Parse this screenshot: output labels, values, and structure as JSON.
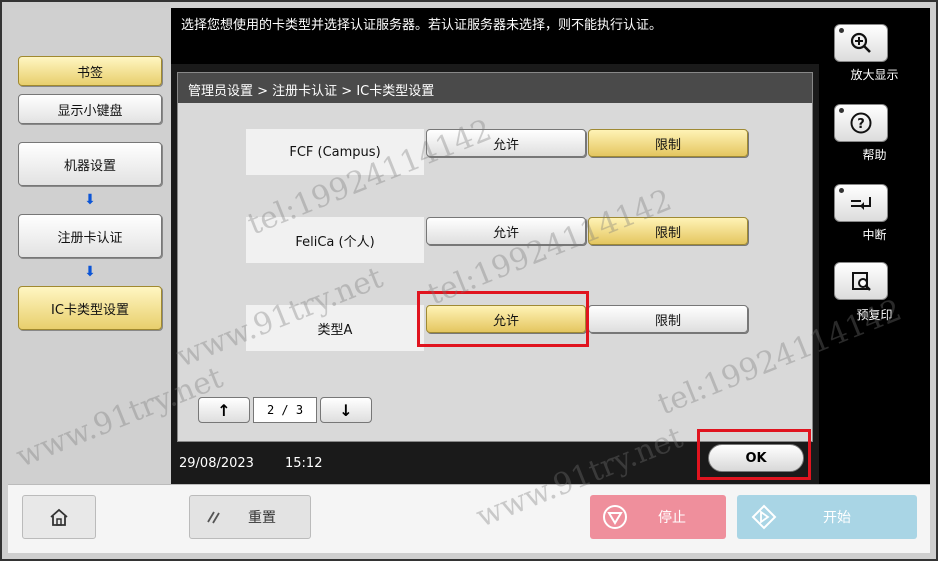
{
  "top_message": "选择您想使用的卡类型并选择认证服务器。若认证服务器未选择，则不能执行认证。",
  "left_nav": {
    "bookmark": "书签",
    "keyboard": "显示小键盘",
    "machine_settings": "机器设置",
    "card_auth": "注册卡认证",
    "ic_card_type": "IC卡类型设置"
  },
  "breadcrumb": "管理员设置 > 注册卡认证 > IC卡类型设置",
  "rows": [
    {
      "label": "FCF (Campus)",
      "allow": "允许",
      "restrict": "限制",
      "selected": "restrict"
    },
    {
      "label": "FeliCa (个人)",
      "allow": "允许",
      "restrict": "限制",
      "selected": "restrict"
    },
    {
      "label": "类型A",
      "allow": "允许",
      "restrict": "限制",
      "selected": "allow"
    }
  ],
  "pager": {
    "text": "2 / 3",
    "up": "↑",
    "down": "↓"
  },
  "status": {
    "date": "29/08/2023",
    "time": "15:12"
  },
  "ok_label": "OK",
  "right_side": {
    "zoom": "放大显示",
    "help": "帮助",
    "interrupt": "中断",
    "preview": "预复印"
  },
  "bottom": {
    "reset": "重置",
    "stop": "停止",
    "start": "开始"
  },
  "watermarks": [
    "www.91try.net",
    "tel:19924114142"
  ],
  "colors": {
    "selected": "#e4c660",
    "highlight": "#e0141f",
    "stop": "#ef8f9c",
    "start": "#a9d5e5"
  }
}
